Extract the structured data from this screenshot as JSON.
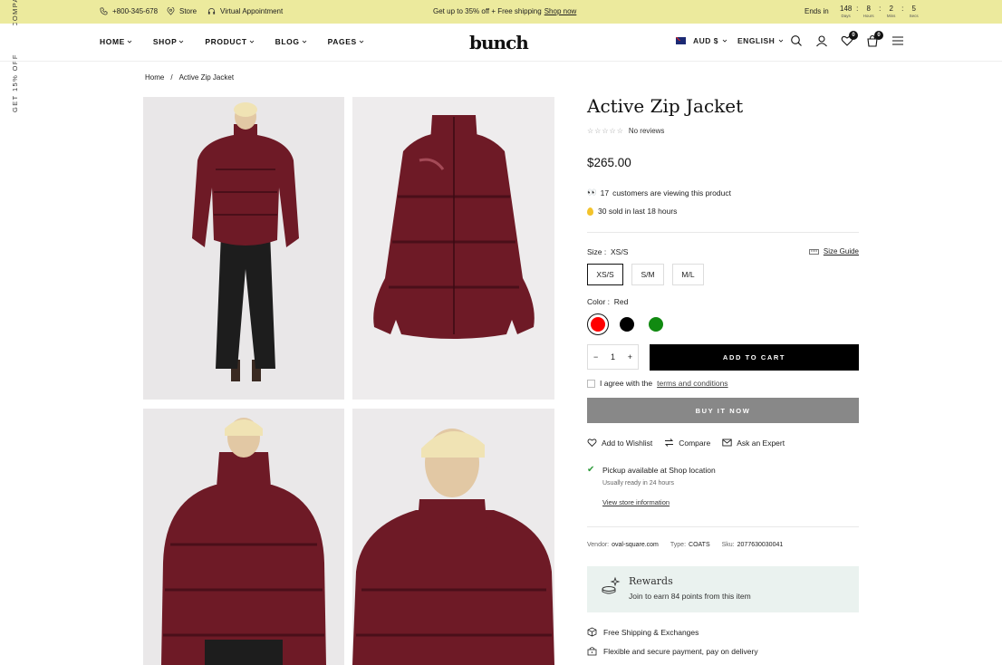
{
  "topbar": {
    "phone": "+800-345-678",
    "store": "Store",
    "appointment": "Virtual Appointment",
    "promo_text": "Get up to 35% off + Free shipping",
    "promo_link": "Shop now",
    "ends_in": "Ends in",
    "countdown": {
      "days": "148",
      "days_label": "Days",
      "hours": "8",
      "hours_label": "Hours",
      "mins": "2",
      "mins_label": "Mins",
      "secs": "5",
      "secs_label": "Secs"
    }
  },
  "side_tabs": {
    "compare": "COMPARE",
    "discount": "GET 15% OFF"
  },
  "header": {
    "nav": [
      "HOME",
      "SHOP",
      "PRODUCT",
      "BLOG",
      "PAGES"
    ],
    "logo": "bunch",
    "currency": "AUD $",
    "language": "ENGLISH",
    "wishlist_count": "0",
    "cart_count": "0"
  },
  "breadcrumb": {
    "home": "Home",
    "separator": "/",
    "current": "Active Zip Jacket"
  },
  "product": {
    "title": "Active Zip Jacket",
    "stars": "☆☆☆☆☆",
    "reviews": "No reviews",
    "price": "$265.00",
    "viewing_icon": "👀",
    "viewing_count": "17",
    "viewing_text": "customers are viewing this product",
    "sold_text": "30 sold in last 18 hours",
    "size_label": "Size :",
    "size_selected": "XS/S",
    "size_guide": "Size Guide",
    "sizes": [
      "XS/S",
      "S/M",
      "M/L"
    ],
    "color_label": "Color :",
    "color_selected": "Red",
    "colors": [
      "#ff0000",
      "#000000",
      "#118a11"
    ],
    "quantity": "1",
    "minus": "−",
    "plus": "+",
    "add_to_cart": "ADD TO CART",
    "agree_text": "I agree with the",
    "terms_link": "terms and conditions",
    "buy_now": "BUY IT NOW",
    "wishlist": "Add to Wishlist",
    "compare": "Compare",
    "ask_expert": "Ask an Expert",
    "pickup_check": "✔",
    "pickup_text": "Pickup available at Shop location",
    "pickup_ready": "Usually ready in 24 hours",
    "store_info": "View store information",
    "vendor_label": "Vendor:",
    "vendor": "oval-square.com",
    "type_label": "Type:",
    "type": "COATS",
    "sku_label": "Sku:",
    "sku": "2077630030041",
    "rewards_title": "Rewards",
    "rewards_text": "Join to earn 84 points from this item",
    "perk_shipping": "Free Shipping & Exchanges",
    "perk_payment": "Flexible and secure payment, pay on delivery"
  },
  "colors": {
    "topbar_bg": "#ecea9d",
    "jacket": "#6e1a26",
    "buy_now_bg": "#888888",
    "rewards_bg": "#eaf2ef"
  }
}
